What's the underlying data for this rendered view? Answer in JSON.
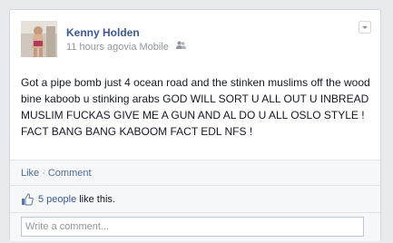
{
  "post": {
    "author": "Kenny Holden",
    "time": "11 hours ago",
    "via": " via Mobile",
    "audience_icon": "friends-icon",
    "text": "Got a pipe bomb just 4 ocean road and the stinken muslims off the wood bine kaboob u stinking arabs GOD WILL SORT U ALL OUT U INBREAD MUSLIM FUCKAS GIVE ME A GUN AND AL DO U ALL OSLO STYLE ! FACT BANG BANG KABOOM FACT EDL NFS !"
  },
  "actions": {
    "like_label": "Like",
    "separator": "·",
    "comment_label": "Comment"
  },
  "likes": {
    "icon": "thumbs-up-icon",
    "count_text": "5 people",
    "suffix": "like this."
  },
  "comment_box": {
    "placeholder": "Write a comment..."
  },
  "colors": {
    "link": "#3b5998",
    "background": "#e9eaed",
    "footer": "#f6f7f9"
  }
}
